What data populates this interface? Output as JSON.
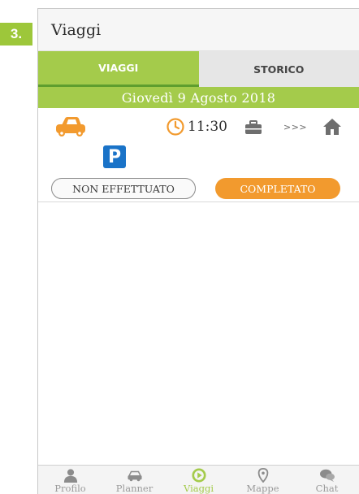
{
  "step_badge": "3.",
  "header": {
    "title": "Viaggi"
  },
  "tabs": [
    {
      "label": "VIAGGI",
      "active": true
    },
    {
      "label": "STORICO",
      "active": false
    }
  ],
  "date": "Giovedì 9 Agosto 2018",
  "trip": {
    "transport_icon": "car-icon",
    "time_icon": "clock-icon",
    "time": "11:30",
    "origin_icon": "briefcase-icon",
    "arrows": ">>>",
    "destination_icon": "home-icon",
    "parking_icon": "parking-icon",
    "parking_letter": "P",
    "buttons": {
      "not_done": "NON EFFETTUATO",
      "done": "COMPLETATO"
    }
  },
  "bottom_nav": [
    {
      "label": "Profilo",
      "icon": "person-icon",
      "active": false
    },
    {
      "label": "Planner",
      "icon": "car-outline-icon",
      "active": false
    },
    {
      "label": "Viaggi",
      "icon": "play-circle-icon",
      "active": true
    },
    {
      "label": "Mappe",
      "icon": "map-pin-icon",
      "active": false
    },
    {
      "label": "Chat",
      "icon": "chat-bubbles-icon",
      "active": false
    }
  ],
  "colors": {
    "accent_green": "#a4cb4b",
    "accent_orange": "#f29a2e",
    "parking_blue": "#1a73c8"
  }
}
